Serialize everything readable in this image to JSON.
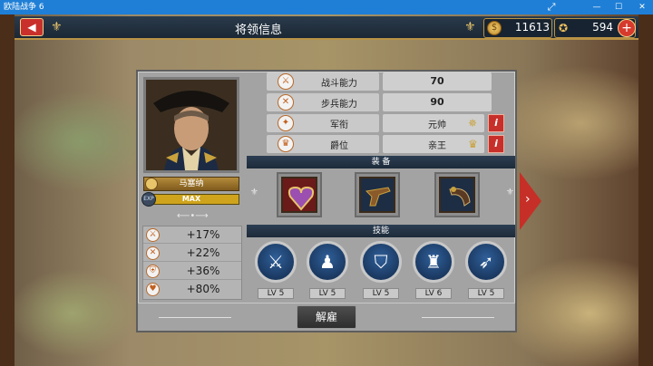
{
  "window": {
    "title": "欧陆战争 6",
    "expand_icon": "expand-icon",
    "minimize": "—",
    "maximize": "☐",
    "close": "✕"
  },
  "header": {
    "title": "将领信息",
    "coins": "11613",
    "medals": "594"
  },
  "general": {
    "name": "马塞纳",
    "exp_label": "EXP",
    "exp_value": "MAX"
  },
  "stats": [
    {
      "label": "战斗能力",
      "value": "70"
    },
    {
      "label": "步兵能力",
      "value": "90"
    },
    {
      "label": "军衔",
      "value": "元帅"
    },
    {
      "label": "爵位",
      "value": "亲王"
    }
  ],
  "bonuses": [
    "+17%",
    "+22%",
    "+36%",
    "+80%"
  ],
  "sections": {
    "equipment": "装 备",
    "skills": "技能"
  },
  "equipment": [
    "purple-heart-medal",
    "flintlock-pistol",
    "powder-horn"
  ],
  "skills": [
    {
      "icon": "infantry-charge-icon",
      "level": "LV 5"
    },
    {
      "icon": "infantry-column-icon",
      "level": "LV 5"
    },
    {
      "icon": "entrenched-soldier-icon",
      "level": "LV 5"
    },
    {
      "icon": "officer-icon",
      "level": "LV 6"
    },
    {
      "icon": "bugle-icon",
      "level": "LV 5"
    }
  ],
  "footer": {
    "dismiss": "解雇"
  },
  "colors": {
    "accent_red": "#c62f27",
    "header_navy": "#1d2b3a",
    "gold": "#b89246",
    "skill_blue": "#2f5f99"
  }
}
